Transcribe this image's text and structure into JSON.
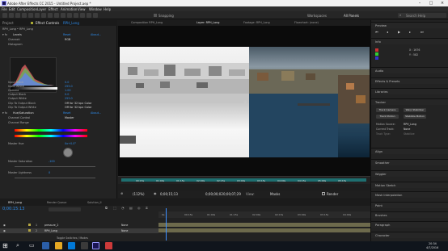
{
  "window": {
    "title": "Adobe After Effects CC 2015 - Untitled Project.aep *"
  },
  "menu": [
    "File",
    "Edit",
    "Composition",
    "Layer",
    "Effect",
    "Animation",
    "View",
    "Window",
    "Help"
  ],
  "toolbar": {
    "snapping_label": "Snapping",
    "workspaces_label": "Workspaces",
    "all_panels_label": "All Panels",
    "search_placeholder": "Search Help"
  },
  "effect_controls": {
    "tab_project": "Project",
    "tab_effect": "Effect Controls",
    "tab_layer": "RPH_Long",
    "breadcrumb": "RPH_Long • RPH_Long",
    "levels": {
      "name": "Levels",
      "reset": "Reset",
      "about": "About...",
      "channel_label": "Channel:",
      "channel_value": "RGB",
      "histogram_label": "Histogram",
      "input_black_label": "Input Black",
      "input_black_value": "0.0",
      "input_white_label": "Input White",
      "input_white_value": "255.0",
      "gamma_label": "Gamma",
      "gamma_value": "1.00",
      "output_black_label": "Output Black",
      "output_black_value": "0.0",
      "output_white_label": "Output White",
      "output_white_value": "255.0",
      "clip_black_label": "Clip To Output Black",
      "clip_black_value": "Off for 32 bpc Color",
      "clip_white_label": "Clip To Output White",
      "clip_white_value": "Off for 32 bpc Color"
    },
    "hue_sat": {
      "name": "Hue/Saturation",
      "reset": "Reset",
      "about": "About...",
      "channel_control_label": "Channel Control",
      "channel_control_value": "Master",
      "channel_range_label": "Channel Range",
      "master_hue_label": "Master Hue",
      "master_hue_value": "0x+0.0°",
      "master_sat_label": "Master Saturation",
      "master_sat_value": "-100",
      "master_light_label": "Master Lightness",
      "master_light_value": "0"
    }
  },
  "composition": {
    "tab_comp": "Composition RPH_Long",
    "tab_layer": "Layer: RPH_Long",
    "tab_footage": "Footage: RPH_Long",
    "tab_flowchart": "Flowchart: (none)",
    "zoom": "(112%)",
    "timecode": "0;00;15;13",
    "resolution": "Full",
    "camera": "Active Camera",
    "view": "1 View",
    "mode": "Masks",
    "render": "Render",
    "ruler_ticks": [
      "00:15s",
      "01:00s",
      "01:15s",
      "02:00s",
      "02:15s",
      "03:00s",
      "03:15s",
      "04:00s",
      "04:15s",
      "05:00s",
      "05:15s",
      "06:00s",
      "06:15s"
    ]
  },
  "right_panel": {
    "preview": "Preview",
    "info": "Info",
    "info_x": "X : 1676",
    "info_y": "Y : 582",
    "audio": "Audio",
    "effects_presets": "Effects & Presets",
    "libraries": "Libraries",
    "tracker": "Tracker",
    "track_camera": "Track Camera",
    "warp_stabilizer": "Warp Stabilizer",
    "track_motion": "Track Motion",
    "stabilize_motion": "Stabilize Motion",
    "motion_source_label": "Motion Source:",
    "motion_source_value": "RPH_Long",
    "current_track_label": "Current Track:",
    "current_track_value": "None",
    "track_type_label": "Track Type:",
    "track_type_value": "Stabilize",
    "align": "Align",
    "smoother": "Smoother",
    "wiggler": "Wiggler",
    "motion_sketch": "Motion Sketch",
    "mask_interpolation": "Mask Interpolation",
    "paint": "Paint",
    "brushes": "Brushes",
    "paragraph": "Paragraph",
    "character": "Character"
  },
  "timeline": {
    "tab_comp": "RPH_Long",
    "tab_render": "Render Queue",
    "tab_other": "Solution_II",
    "timecode": "0;00:15:13",
    "layer1_num": "1",
    "layer1_name": "pressure_2",
    "layer1_mode": "None",
    "layer2_num": "2",
    "layer2_name": "RPH_Long",
    "layer2_mode": "None",
    "toggle_label": "Toggle Switches / Modes",
    "ticks": [
      "0s",
      "00:15s",
      "01:00s",
      "01:15s",
      "02:00s",
      "02:15s",
      "03:00s",
      "03:15s",
      "04:00s",
      "04:15s",
      "05:00s"
    ]
  },
  "taskbar": {
    "time": "20:34",
    "date": "4/7/2016"
  }
}
